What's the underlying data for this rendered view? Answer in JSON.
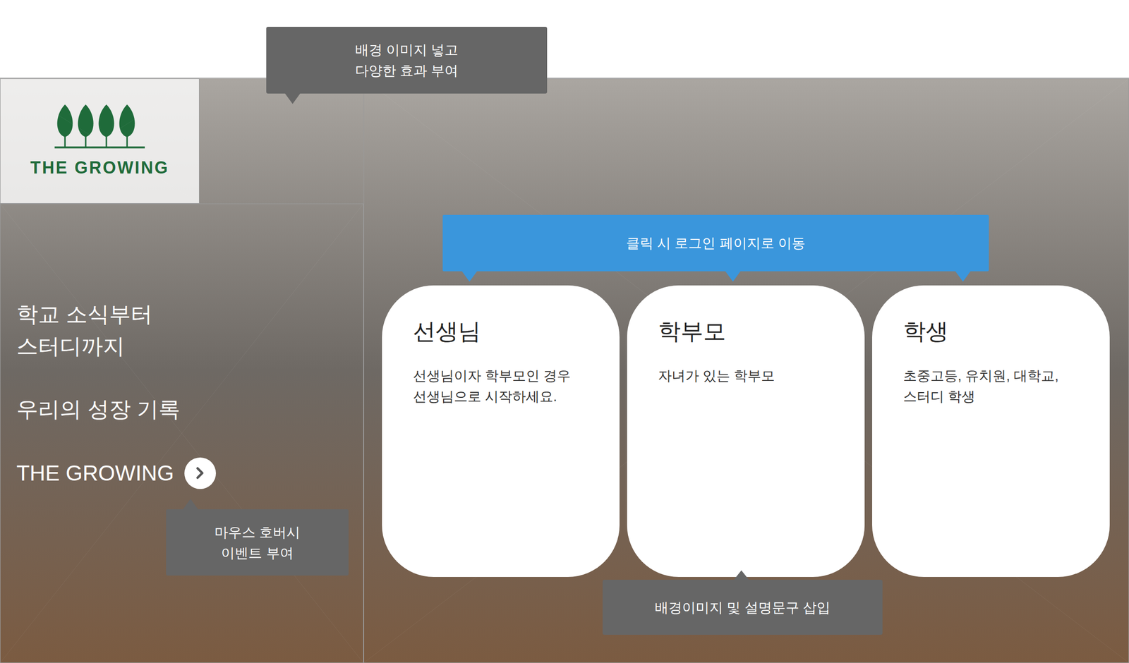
{
  "logo": {
    "text": "THE GROWING"
  },
  "hero": {
    "lines": [
      "학교 소식부터",
      "스터디까지"
    ],
    "subtitle": "우리의 성장 기록",
    "link": "THE GROWING"
  },
  "cards": [
    {
      "title": "선생님",
      "description": [
        "선생님이자 학부모인 경우",
        "선생님으로 시작하세요."
      ]
    },
    {
      "title": "학부모",
      "description": [
        "자녀가 있는 학부모"
      ]
    },
    {
      "title": "학생",
      "description": [
        "초중고등, 유치원, 대학교,",
        "스터디 학생"
      ]
    }
  ],
  "notes": {
    "background": [
      "배경 이미지 넣고",
      "다양한 효과 부여"
    ],
    "cards_link": "클릭 시 로그인 페이지로 이동",
    "hover": [
      "마우스 호버시",
      "이벤트 부여"
    ],
    "card_content": "배경이미지 및 설명문구 삽입"
  }
}
